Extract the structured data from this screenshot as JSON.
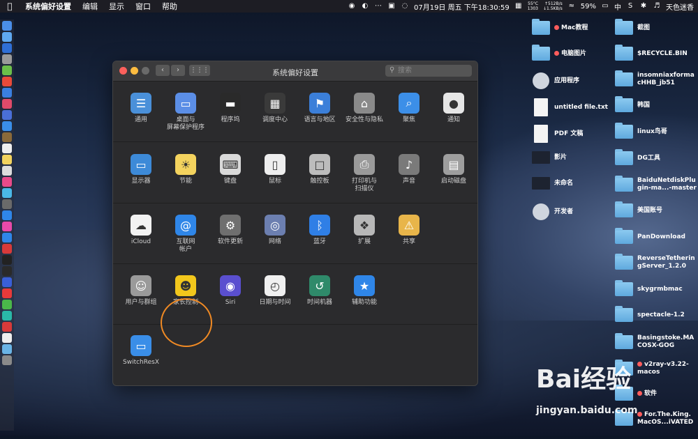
{
  "menubar": {
    "apple": "",
    "app_name": "系统偏好设置",
    "menus": [
      "编辑",
      "显示",
      "窗口",
      "帮助"
    ],
    "temp": "55°C",
    "temp2": "1303",
    "net_up": "↑512B/s",
    "net_down": "↓1.5KB/s",
    "datetime": "07月19日 周五 下午18:30:59",
    "battery": "59%",
    "input_method": "中",
    "user": "天色迷香"
  },
  "window": {
    "title": "系统偏好设置",
    "search_placeholder": "搜索",
    "rows": [
      [
        {
          "label": "通用",
          "icon": "general-icon",
          "color": "#4a90d9"
        },
        {
          "label": "桌面与\n屏幕保护程序",
          "icon": "desktop-icon",
          "color": "#5b8ee6"
        },
        {
          "label": "程序坞",
          "icon": "dock-icon",
          "color": "#2a2a2a"
        },
        {
          "label": "调度中心",
          "icon": "mission-control-icon",
          "color": "#3a3a3a"
        },
        {
          "label": "语言与地区",
          "icon": "flag-icon",
          "color": "#3b7fd9"
        },
        {
          "label": "安全性与隐私",
          "icon": "house-icon",
          "color": "#8a8a8a"
        },
        {
          "label": "聚焦",
          "icon": "spotlight-icon",
          "color": "#3c8fe8"
        },
        {
          "label": "通知",
          "icon": "notifications-icon",
          "color": "#e6e6e6"
        }
      ],
      [
        {
          "label": "显示器",
          "icon": "display-icon",
          "color": "#3d8ad8"
        },
        {
          "label": "节能",
          "icon": "bulb-icon",
          "color": "#f4d35e"
        },
        {
          "label": "键盘",
          "icon": "keyboard-icon",
          "color": "#d9d9d9"
        },
        {
          "label": "鼠标",
          "icon": "mouse-icon",
          "color": "#eeeeee"
        },
        {
          "label": "触控板",
          "icon": "trackpad-icon",
          "color": "#bcbcbc"
        },
        {
          "label": "打印机与\n扫描仪",
          "icon": "printer-icon",
          "color": "#9a9a9a"
        },
        {
          "label": "声音",
          "icon": "speaker-icon",
          "color": "#7a7a7a"
        },
        {
          "label": "启动磁盘",
          "icon": "disk-icon",
          "color": "#9e9e9e"
        }
      ],
      [
        {
          "label": "iCloud",
          "icon": "icloud-icon",
          "color": "#f2f2f2"
        },
        {
          "label": "互联网\n帐户",
          "icon": "at-icon",
          "color": "#2f86e8"
        },
        {
          "label": "软件更新",
          "icon": "gear-icon",
          "color": "#6f6f6f"
        },
        {
          "label": "网络",
          "icon": "globe-icon",
          "color": "#6c7fb0"
        },
        {
          "label": "蓝牙",
          "icon": "bluetooth-icon",
          "color": "#2f7fe6"
        },
        {
          "label": "扩展",
          "icon": "puzzle-icon",
          "color": "#b8b8b8"
        },
        {
          "label": "共享",
          "icon": "sharing-icon",
          "color": "#e8b54a"
        }
      ],
      [
        {
          "label": "用户与群组",
          "icon": "users-icon",
          "color": "#9a9a9a"
        },
        {
          "label": "家长控制",
          "icon": "parental-icon",
          "color": "#f2c71c"
        },
        {
          "label": "Siri",
          "icon": "siri-icon",
          "color": "#5a4fcf"
        },
        {
          "label": "日期与时间",
          "icon": "clock-icon",
          "color": "#f0f0f0"
        },
        {
          "label": "时间机器",
          "icon": "time-machine-icon",
          "color": "#2f8a6a"
        },
        {
          "label": "辅助功能",
          "icon": "accessibility-icon",
          "color": "#2f86e8"
        }
      ],
      [
        {
          "label": "SwitchResX",
          "icon": "monitor-icon",
          "color": "#3a8ee8"
        }
      ]
    ]
  },
  "desktop": {
    "col1": [
      {
        "label": "Mac教程",
        "type": "folder",
        "tag": true
      },
      {
        "label": "电脑图片",
        "type": "folder",
        "tag": true
      },
      {
        "label": "应用程序",
        "type": "app",
        "tag": false
      },
      {
        "label": "untitled file.txt",
        "type": "file",
        "tag": false
      },
      {
        "label": "PDF 文稿",
        "type": "file",
        "tag": false
      },
      {
        "label": "影片",
        "type": "image",
        "tag": false
      },
      {
        "label": "未命名",
        "type": "image",
        "tag": false
      },
      {
        "label": "开发者",
        "type": "app",
        "tag": false
      }
    ],
    "col2": [
      {
        "label": "截图",
        "tag": false
      },
      {
        "label": "$RECYCLE.BIN",
        "tag": false
      },
      {
        "label": "insomniaxforma\ncHHB_jb51",
        "tag": false
      },
      {
        "label": "韩国",
        "tag": false
      },
      {
        "label": "linux鸟哥",
        "tag": false
      },
      {
        "label": "DG工具",
        "tag": false
      },
      {
        "label": "BaiduNetdiskPlu\ngin-ma...-master",
        "tag": false
      },
      {
        "label": "美国账号",
        "tag": false
      },
      {
        "label": "PanDownload",
        "tag": false
      },
      {
        "label": "ReverseTetherin\ngServer_1.2.0",
        "tag": false
      },
      {
        "label": "skygrmbmac",
        "tag": false
      },
      {
        "label": "spectacle-1.2",
        "tag": false
      },
      {
        "label": "Basingstoke.MA\nCOSX-GOG",
        "tag": false
      },
      {
        "label": "v2ray-v3.22-\nmacos",
        "tag": true
      },
      {
        "label": "软件",
        "tag": true
      },
      {
        "label": "For.The.King.\nMacOS...iVATED",
        "tag": true
      }
    ]
  },
  "watermark": {
    "text": "Bai经验",
    "url": "jingyan.baidu.com"
  },
  "colors": {
    "accent": "#f08a24",
    "tag_red": "#ff5c5c",
    "folder_blue": "#6ab4e6"
  }
}
